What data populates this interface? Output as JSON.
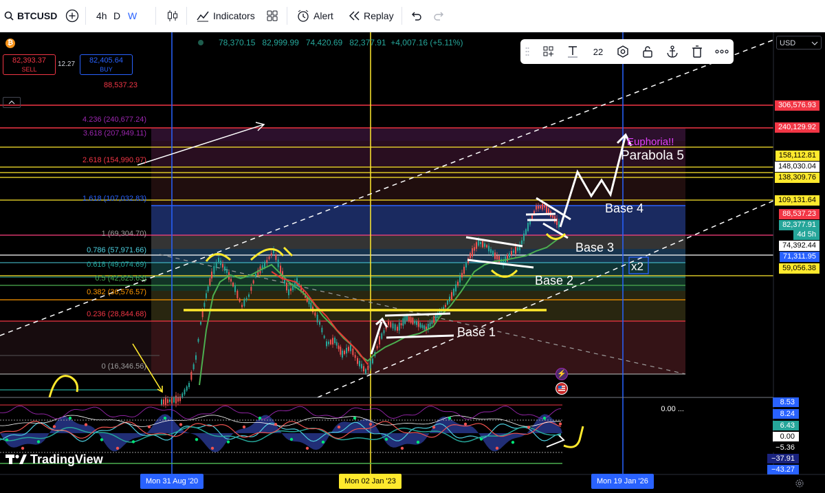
{
  "toolbar": {
    "symbol": "BTCUSD",
    "intervals": [
      "4h",
      "D",
      "W"
    ],
    "indicators_label": "Indicators",
    "alert_label": "Alert",
    "replay_label": "Replay"
  },
  "ohlc": {
    "open": "78,370.15",
    "high": "82,999.99",
    "low": "74,420.69",
    "close": "82,377.91",
    "change": "+4,007.16 (+5.11%)"
  },
  "trade": {
    "sell_price": "82,393.37",
    "sell_label": "SELL",
    "spread": "12.27",
    "buy_price": "82,405.64",
    "buy_label": "BUY",
    "extra_price": "88,537.23"
  },
  "drawing_toolbar": {
    "font_size": "22"
  },
  "currency": "USD",
  "fib_levels": {
    "l4236": "4.236 (240,677.24)",
    "l3618": "3.618 (207,949.11)",
    "l2618": "2.618 (154,990.97)",
    "l1618": "1.618 (107,032.83)",
    "l1": "1 (69,304.70)",
    "l0786": "0.786 (57,971.66)",
    "l0618": "0.618 (49,074.69)",
    "l05": "0.5 (42,825.63)",
    "l0382": "0.382 (36,576.57)",
    "l0236": "0.236 (28,844.68)",
    "l0": "0 (16,346.56)"
  },
  "annotations": {
    "euphoria": "Euphoria!!",
    "parabola": "Parabola 5",
    "base4": "Base 4",
    "base3": "Base 3",
    "base2": "Base 2",
    "base1": "Base 1",
    "x2": "x2"
  },
  "price_axis": {
    "p306": "306,576.93",
    "p240": "240,129.92",
    "p158": "158,112.81",
    "p148": "148,030.04",
    "p138": "138,309.76",
    "p109": "109,131.64",
    "p88": "88,537.23",
    "p82": "82,377.91",
    "countdown": "4d 5h",
    "p74": "74,392.44",
    "p71": "71,311.95",
    "p59": "59,056.38"
  },
  "oscillator": {
    "top_value": "0.00 ...",
    "tags": [
      "8.53",
      "8.24",
      "6.43",
      "0.00",
      "−5.36",
      "−37.91",
      "−43.27"
    ]
  },
  "time_axis": {
    "d1": "Mon 31 Aug '20",
    "d2": "Mon 02 Jan '23",
    "d3": "Mon 19 Jan '26"
  },
  "watermark": "TradingView",
  "colors": {
    "accent_blue": "#2962ff",
    "bull": "#26a69a",
    "bear": "#ef5350",
    "annotation_yellow": "#ffe92d"
  }
}
